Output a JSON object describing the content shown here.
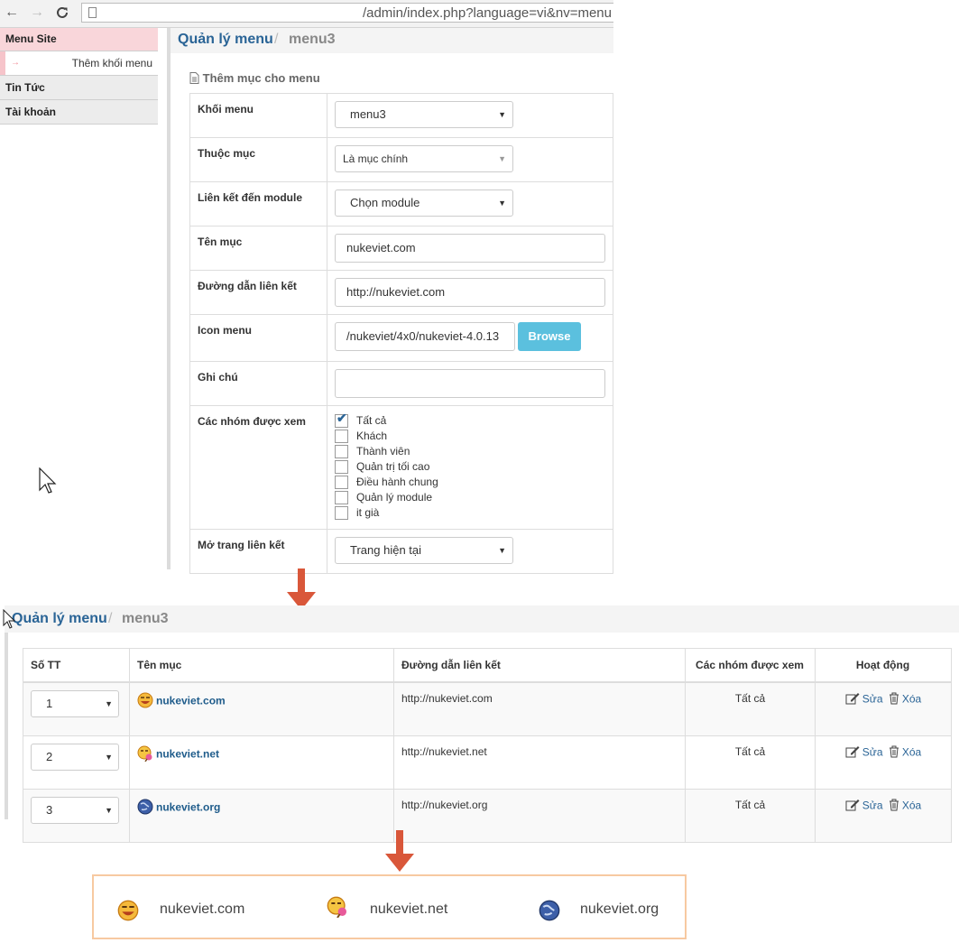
{
  "browser": {
    "back_icon": "←",
    "forward_icon": "→",
    "reload_icon": "C",
    "url": "/admin/index.php?language=vi&nv=menu"
  },
  "sidebar": {
    "items": [
      {
        "label": "Menu Site",
        "active": true
      },
      {
        "label": "Thêm khối menu",
        "sub": true
      },
      {
        "label": "Tin Tức"
      },
      {
        "label": "Tài khoản"
      }
    ]
  },
  "breadcrumb": {
    "root": "Quản lý menu",
    "separator": "/",
    "current": "menu3"
  },
  "form": {
    "title": "Thêm mục cho menu",
    "khoi_menu": {
      "label": "Khối menu",
      "value": "menu3"
    },
    "thuoc_muc": {
      "label": "Thuộc mục",
      "value": "Là mục chính"
    },
    "module": {
      "label": "Liên kết đến module",
      "value": "Chọn module"
    },
    "ten_muc": {
      "label": "Tên mục",
      "value": "nukeviet.com"
    },
    "duong_dan": {
      "label": "Đường dẫn liên kết",
      "value": "http://nukeviet.com"
    },
    "icon_menu": {
      "label": "Icon menu",
      "value": "/nukeviet/4x0/nukeviet-4.0.13",
      "browse_label": "Browse"
    },
    "ghi_chu": {
      "label": "Ghi chú",
      "value": ""
    },
    "nhom": {
      "label": "Các nhóm được xem",
      "options": [
        {
          "label": "Tất cả",
          "checked": true
        },
        {
          "label": "Khách",
          "checked": false
        },
        {
          "label": "Thành viên",
          "checked": false
        },
        {
          "label": "Quản trị tối cao",
          "checked": false
        },
        {
          "label": "Điều hành chung",
          "checked": false
        },
        {
          "label": "Quản lý module",
          "checked": false
        },
        {
          "label": "it già",
          "checked": false
        }
      ]
    },
    "mo_trang": {
      "label": "Mở trang liên kết",
      "value": "Trang hiện tại"
    }
  },
  "list": {
    "headers": [
      "Số TT",
      "Tên mục",
      "Đường dẫn liên kết",
      "Các nhóm được xem",
      "Hoạt động"
    ],
    "rows": [
      {
        "order": "1",
        "name": "nukeviet.com",
        "url": "http://nukeviet.com",
        "groups": "Tất cả",
        "edit": "Sửa",
        "delete": "Xóa",
        "icon": "laughing-smiley-icon"
      },
      {
        "order": "2",
        "name": "nukeviet.net",
        "url": "http://nukeviet.net",
        "groups": "Tất cả",
        "edit": "Sửa",
        "delete": "Xóa",
        "icon": "icecream-smiley-icon"
      },
      {
        "order": "3",
        "name": "nukeviet.org",
        "url": "http://nukeviet.org",
        "groups": "Tất cả",
        "edit": "Sửa",
        "delete": "Xóa",
        "icon": "globe-icon"
      }
    ]
  },
  "preview": {
    "items": [
      "nukeviet.com",
      "nukeviet.net",
      "nukeviet.org"
    ]
  },
  "colors": {
    "accent": "#2a6496",
    "arrow": "#d9573a",
    "browse": "#5bc0de",
    "sidebar_active": "#f9d6da",
    "preview_border": "#f7c9a1"
  }
}
